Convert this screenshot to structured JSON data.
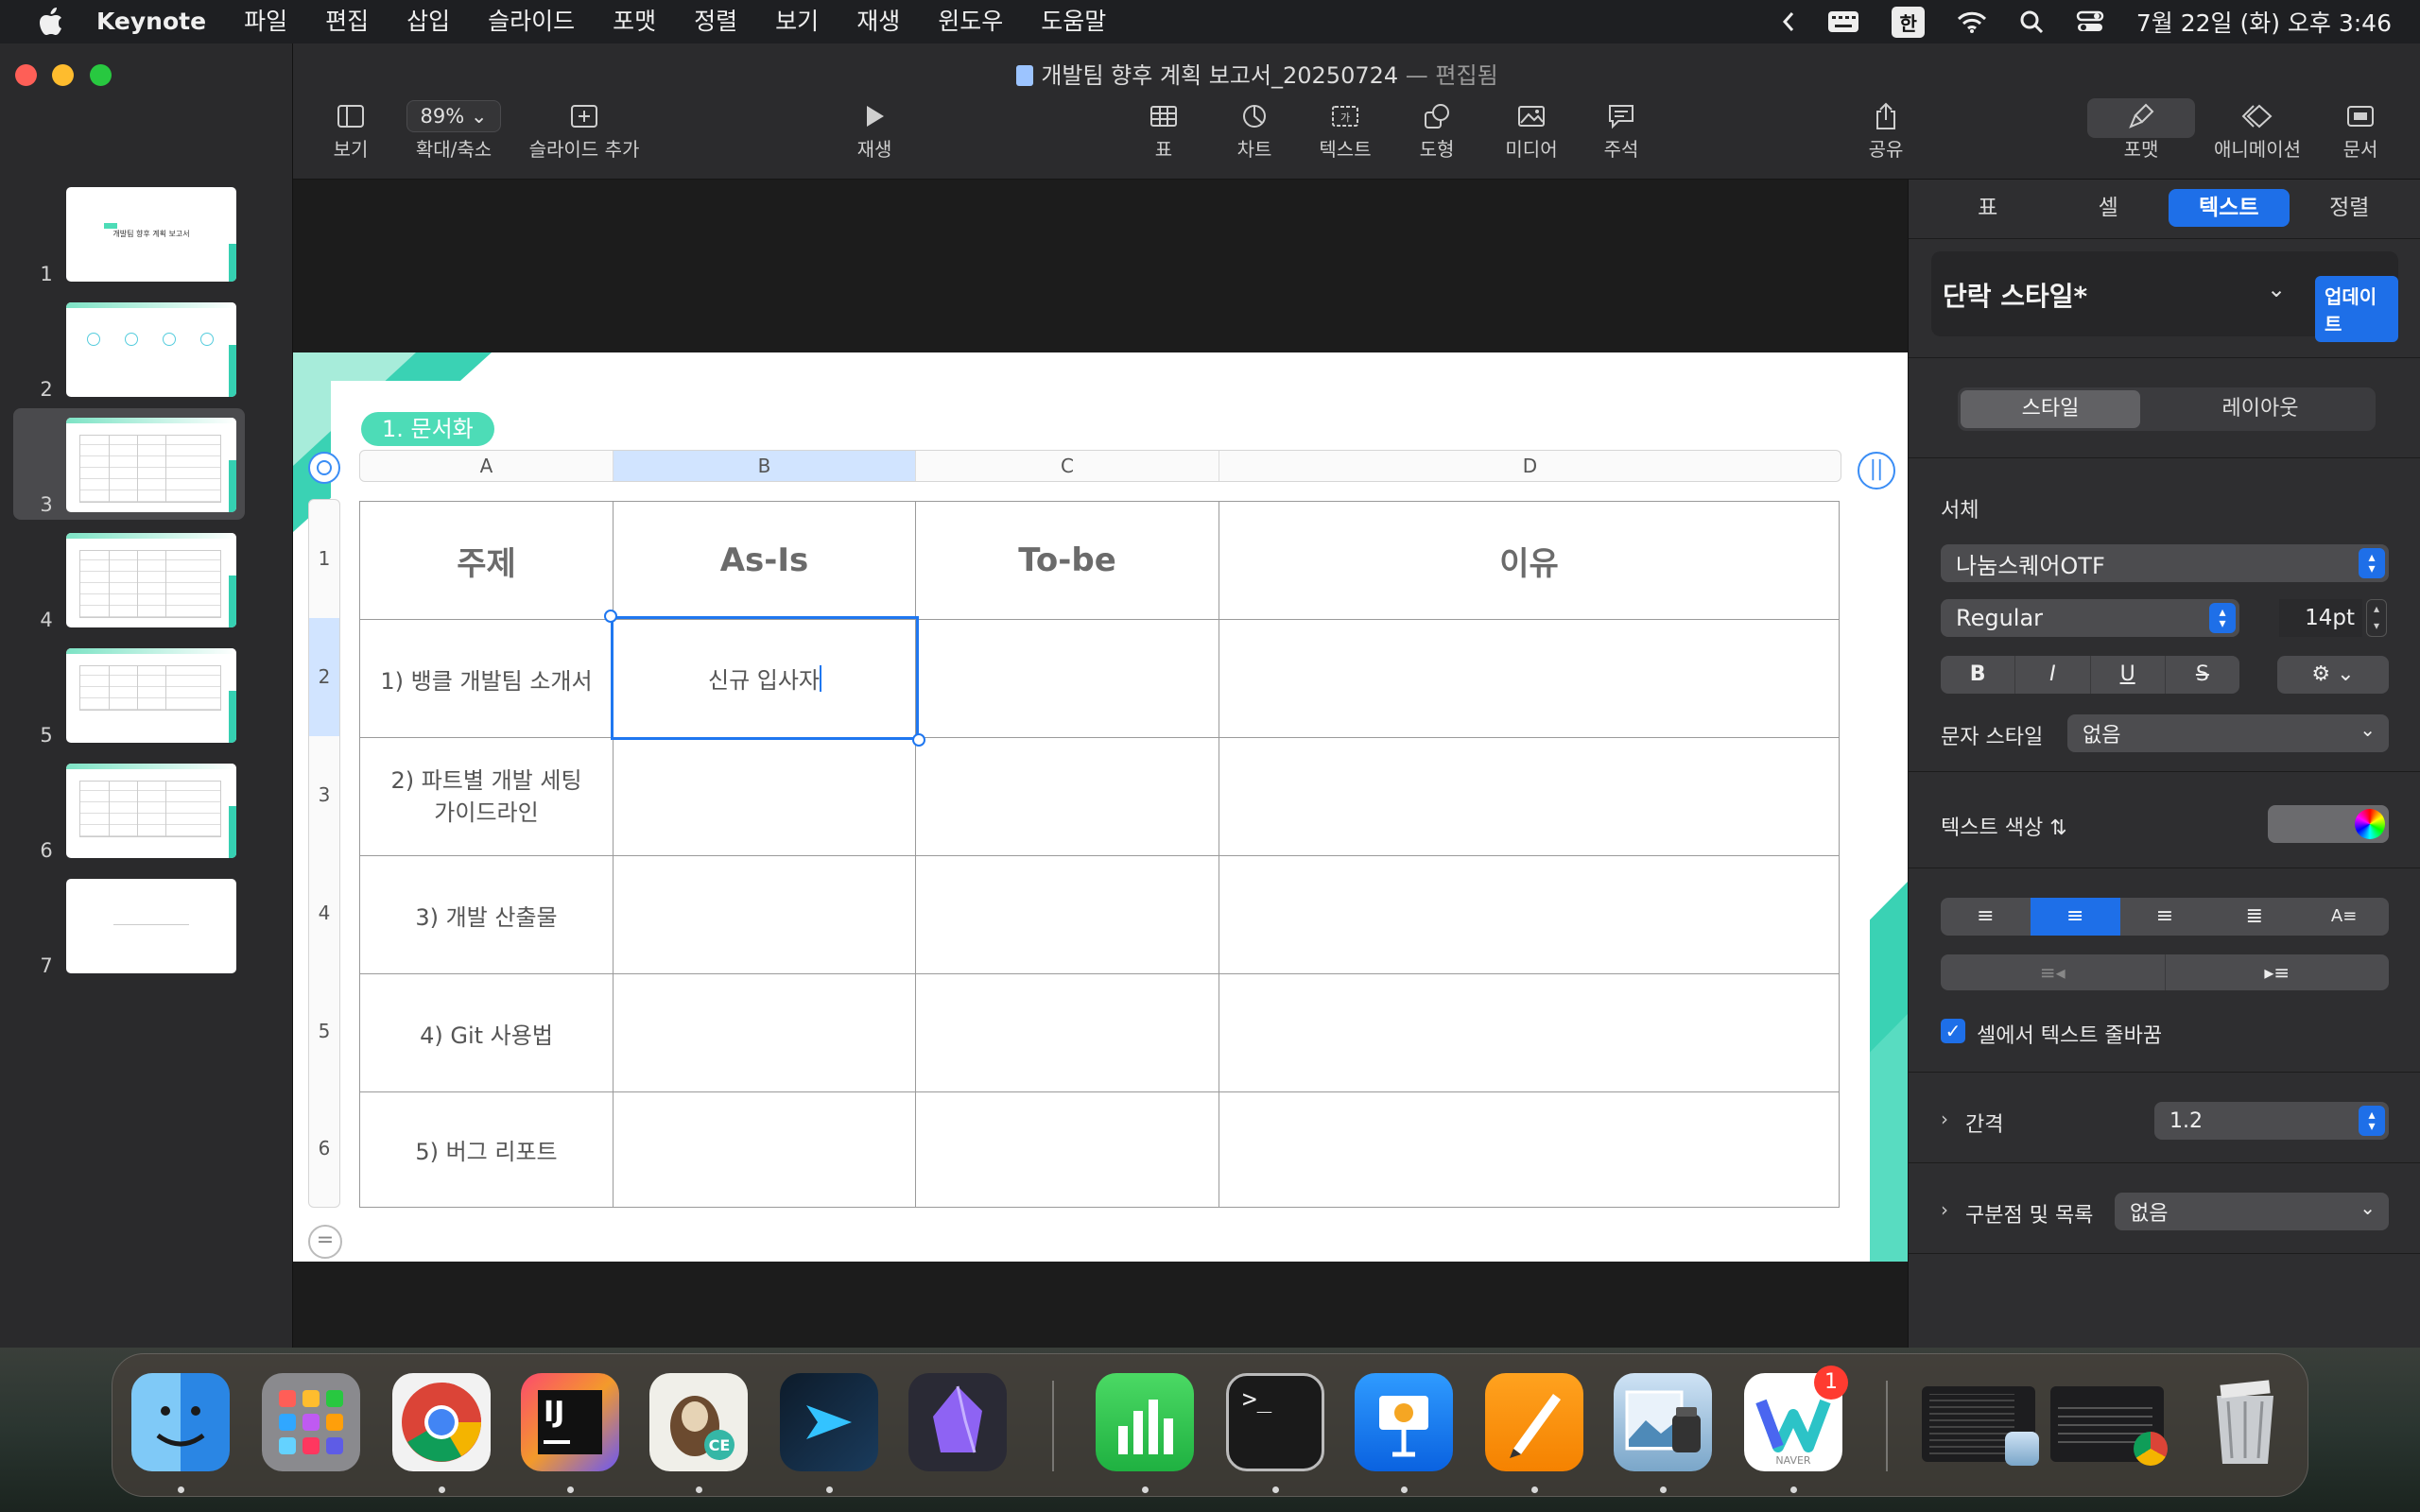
{
  "menubar": {
    "items": [
      "Keynote",
      "파일",
      "편집",
      "삽입",
      "슬라이드",
      "포맷",
      "정렬",
      "보기",
      "재생",
      "윈도우",
      "도움말"
    ],
    "input_source": "한",
    "clock": "7월 22일 (화) 오후 3:46"
  },
  "window": {
    "title": "개발팀 향후 계획 보고서_20250724",
    "status": "— 편집됨"
  },
  "toolbar": {
    "view": "보기",
    "zoom_value": "89%",
    "zoom": "확대/축소",
    "add_slide": "슬라이드 추가",
    "play": "재생",
    "table": "표",
    "chart": "차트",
    "text": "텍스트",
    "shape": "도형",
    "media": "미디어",
    "comment": "주석",
    "share": "공유",
    "format": "포맷",
    "animate": "애니메이션",
    "document": "문서"
  },
  "slides": [
    {
      "num": "1",
      "title": "개발팀 향후 계획 보고서"
    },
    {
      "num": "2"
    },
    {
      "num": "3",
      "selected": true
    },
    {
      "num": "4"
    },
    {
      "num": "5"
    },
    {
      "num": "6"
    },
    {
      "num": "7"
    }
  ],
  "slide": {
    "tag": "1. 문서화",
    "col_letters": [
      "A",
      "B",
      "C",
      "D"
    ],
    "row_numbers": [
      "1",
      "2",
      "3",
      "4",
      "5",
      "6"
    ],
    "headers": [
      "주제",
      "As-Is",
      "To-be",
      "이유"
    ],
    "rows": [
      [
        "1) 뱅클 개발팀 소개서",
        "신규 입사자",
        "",
        ""
      ],
      [
        "2) 파트별 개발 세팅\n가이드라인",
        "",
        "",
        ""
      ],
      [
        "3) 개발 산출물",
        "",
        "",
        ""
      ],
      [
        "4) Git 사용법",
        "",
        "",
        ""
      ],
      [
        "5) 버그 리포트",
        "",
        "",
        ""
      ]
    ]
  },
  "inspector": {
    "tabs": [
      "표",
      "셀",
      "텍스트",
      "정렬"
    ],
    "active_tab": "텍스트",
    "paragraph_style": "단락 스타일*",
    "update_button": "업데이트",
    "segments": [
      "스타일",
      "레이아웃"
    ],
    "font_label": "서체",
    "font_family": "나눔스퀘어OTF",
    "font_weight": "Regular",
    "font_size": "14pt",
    "char_style_label": "문자 스타일",
    "char_style_value": "없음",
    "text_color_label": "텍스트 색상",
    "wrap_label": "셀에서 텍스트 줄바꿈",
    "spacing_label": "간격",
    "spacing_value": "1.2",
    "bullets_label": "구분점 및 목록",
    "bullets_value": "없음"
  },
  "dock": {
    "apps": [
      "Finder",
      "Launchpad",
      "Chrome",
      "IntelliJ IDEA CE",
      "DBeaver CE",
      "Xcode Cloud",
      "Obsidian",
      "Numbers",
      "Terminal",
      "Keynote",
      "Pages",
      "Preview",
      "Naver Whale",
      "Window 1",
      "Window 2",
      "Trash"
    ],
    "whale_badge": "1",
    "naver_label": "NAVER"
  },
  "colors": {
    "accent": "#1e6fe8",
    "teal": "#3ad2b4",
    "tag": "#4ddcb7"
  }
}
